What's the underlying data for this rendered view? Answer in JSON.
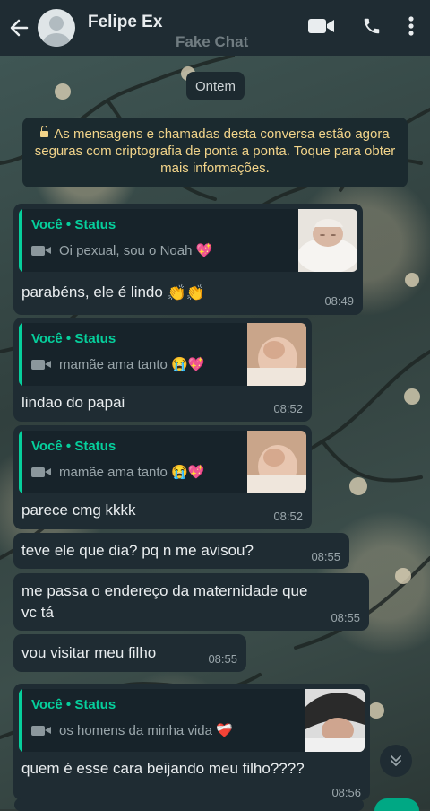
{
  "header": {
    "title": "Felipe Ex",
    "watermark": "Fake Chat",
    "icons": [
      "back-arrow-icon",
      "video-call-icon",
      "phone-icon",
      "more-vert-icon"
    ]
  },
  "date_chip": "Ontem",
  "encryption": {
    "text": "As mensagens e chamadas desta conversa estão agora seguras com criptografia de ponta a ponta. Toque para obter mais informações."
  },
  "messages": [
    {
      "quote_name": "Você • Status",
      "quote_text": "Oi pexual, sou o Noah",
      "quote_emoji": "💖",
      "text": "parabéns, ele é lindo",
      "text_emoji": "👏👏",
      "time": "08:49"
    },
    {
      "quote_name": "Você • Status",
      "quote_text": "mamãe ama tanto",
      "quote_emoji": "😭💖",
      "text": "lindao do papai",
      "time": "08:52"
    },
    {
      "quote_name": "Você • Status",
      "quote_text": "mamãe ama tanto",
      "quote_emoji": "😭💖",
      "text": "parece cmg kkkk",
      "time": "08:52"
    },
    {
      "text": "teve ele que dia? pq n me avisou?",
      "time": "08:55"
    },
    {
      "text_line1": "me passa o endereço da maternidade que",
      "text_line2": "vc tá",
      "time": "08:55"
    },
    {
      "text": "vou visitar meu filho",
      "time": "08:55"
    },
    {
      "quote_name": "Você • Status",
      "quote_text": "os homens da minha vida",
      "quote_emoji": "❤️‍🩹",
      "text": "quem é esse cara beijando meu filho????",
      "time": "08:56"
    }
  ],
  "colors": {
    "header_bg": "#1f2c33",
    "bubble_bg": "#1f2c33",
    "accent_green": "#06cf9c",
    "encryption_text": "#f2d48a"
  }
}
